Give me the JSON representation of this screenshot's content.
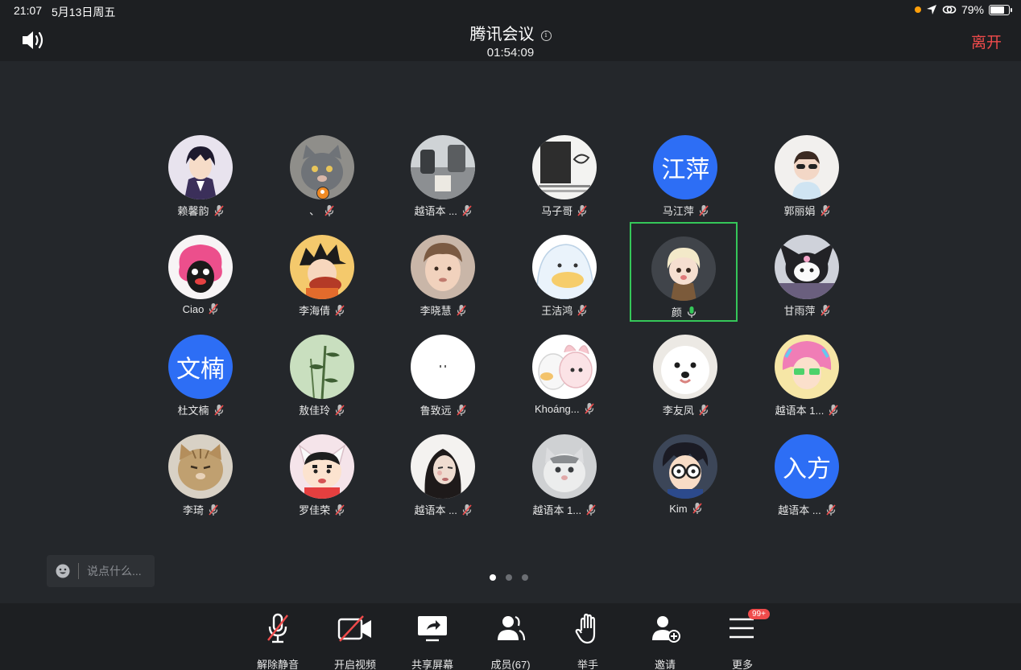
{
  "status_bar": {
    "time": "21:07",
    "date": "5月13日周五",
    "battery": "79%",
    "battery_level": 0.79
  },
  "header": {
    "title": "腾讯会议",
    "elapsed": "01:54:09",
    "leave_label": "离开"
  },
  "participants": [
    {
      "name": "赖馨韵",
      "avatar": "anime-boy",
      "muted": true
    },
    {
      "name": "、",
      "avatar": "gray-cat",
      "muted": true,
      "host": true
    },
    {
      "name": "越语本 ...",
      "avatar": "photo",
      "muted": true
    },
    {
      "name": "马子哥",
      "avatar": "sketch",
      "muted": true
    },
    {
      "name": "马江萍",
      "avatar_text": "江萍",
      "muted": true
    },
    {
      "name": "郭丽娟",
      "avatar": "toddler",
      "muted": true
    },
    {
      "name": "Ciao",
      "avatar": "cartoon-pink",
      "muted": true
    },
    {
      "name": "李海倩",
      "avatar": "goku",
      "muted": true
    },
    {
      "name": "李晓慧",
      "avatar": "child",
      "muted": true
    },
    {
      "name": "王洁鸿",
      "avatar": "duck",
      "muted": true
    },
    {
      "name": "颜",
      "avatar": "doll",
      "muted": false,
      "speaking": true
    },
    {
      "name": "甘雨萍",
      "avatar": "kuromi",
      "muted": true
    },
    {
      "name": "杜文楠",
      "avatar_text": "文楠",
      "muted": true
    },
    {
      "name": "敖佳玲",
      "avatar": "bamboo",
      "muted": true
    },
    {
      "name": "鲁致远",
      "avatar": "white",
      "muted": true
    },
    {
      "name": "Khoáng...",
      "avatar": "duck-bunny",
      "muted": true
    },
    {
      "name": "李友凤",
      "avatar": "samoyed",
      "muted": true
    },
    {
      "name": "越语本 1...",
      "avatar": "anime-girl",
      "muted": true
    },
    {
      "name": "李琦",
      "avatar": "cat-tabby",
      "muted": true
    },
    {
      "name": "罗佳荣",
      "avatar": "shinchan",
      "muted": true
    },
    {
      "name": "越语本 ...",
      "avatar": "woman",
      "muted": true
    },
    {
      "name": "越语本 1...",
      "avatar": "cat-snow",
      "muted": true
    },
    {
      "name": "Kim",
      "avatar": "conan",
      "muted": true
    },
    {
      "name": "越语本 ...",
      "avatar_text": "入方",
      "muted": true
    }
  ],
  "chat": {
    "placeholder": "说点什么..."
  },
  "pager": {
    "pages": 3,
    "current": 1
  },
  "toolbar": {
    "unmute": "解除静音",
    "video": "开启视频",
    "share": "共享屏幕",
    "members": "成员(67)",
    "raise_hand": "举手",
    "invite": "邀请",
    "more": "更多",
    "more_badge": "99+"
  },
  "colors": {
    "accent_blue": "#2d6ef5",
    "leave_red": "#f04b4b",
    "speaking_green": "#35c759",
    "host_orange": "#f08a24"
  }
}
